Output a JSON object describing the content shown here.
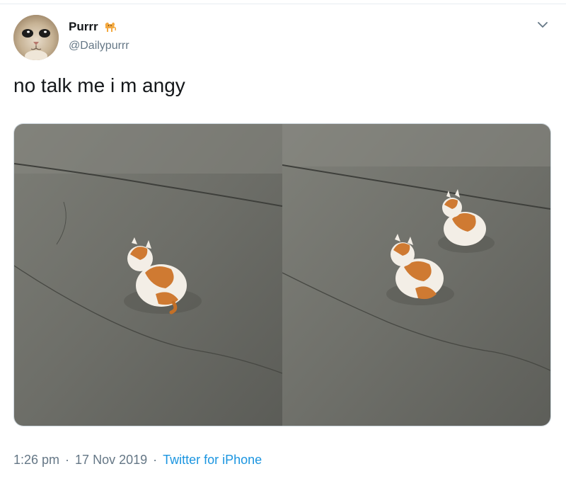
{
  "tweet": {
    "author": {
      "display_name": "Purrr",
      "name_emoji": "cat-emoji",
      "handle": "@Dailypurrr",
      "avatar": "cat-face-avatar"
    },
    "text": "no talk me i m angy",
    "media": [
      {
        "subject": "kitten-on-pavement",
        "kittens": 1
      },
      {
        "subject": "kittens-on-pavement",
        "kittens": 2
      }
    ],
    "meta": {
      "time": "1:26 pm",
      "separator": "·",
      "date": "17 Nov 2019",
      "source": "Twitter for iPhone"
    },
    "menu_icon": "chevron-down-icon"
  },
  "colors": {
    "text": "#14171a",
    "secondary": "#657786",
    "link": "#1b95e0",
    "border": "#ccd6dd"
  }
}
